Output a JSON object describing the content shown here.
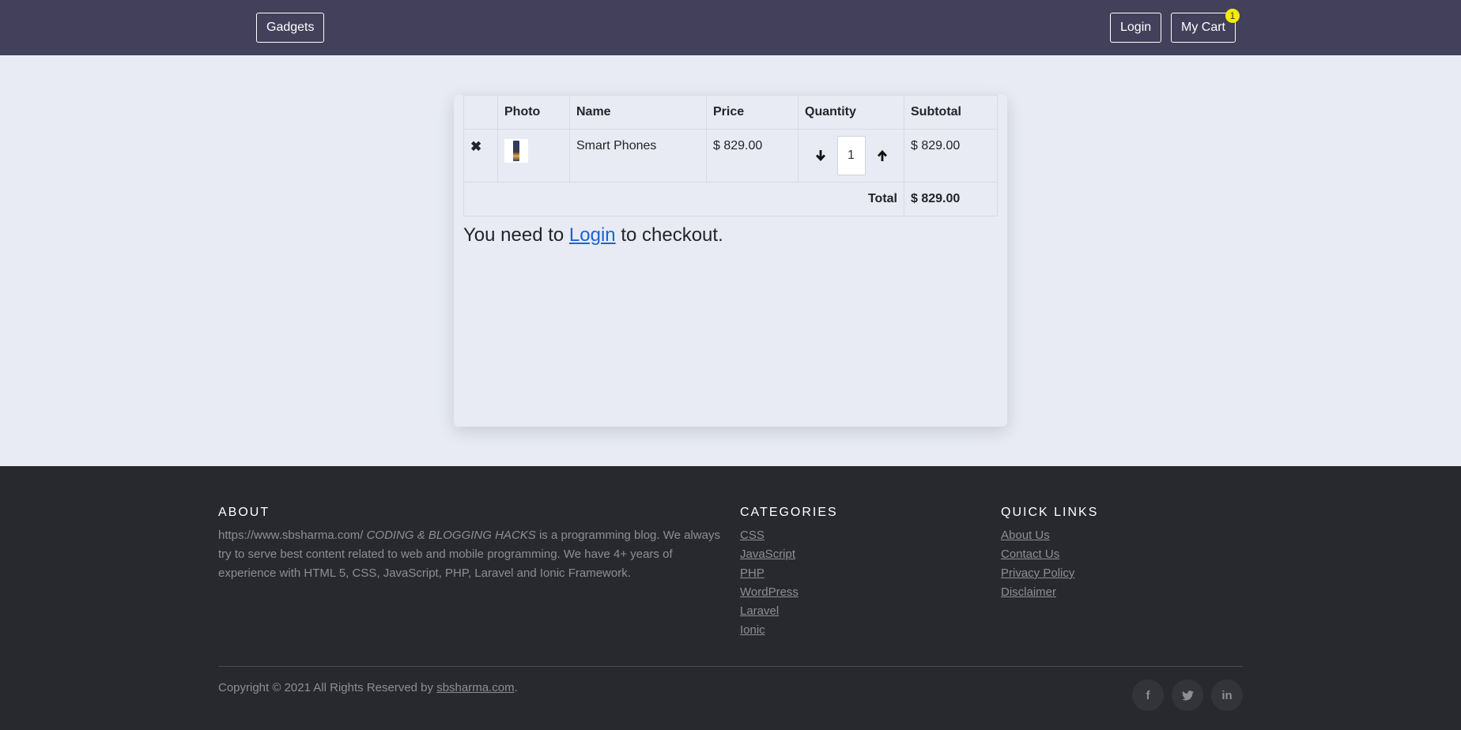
{
  "navbar": {
    "brand": "Gadgets",
    "login_label": "Login",
    "cart_label": "My Cart",
    "cart_count": "1"
  },
  "cart": {
    "headers": [
      "",
      "Photo",
      "Name",
      "Price",
      "Quantity",
      "Subtotal"
    ],
    "items": [
      {
        "remove_icon": "close-icon",
        "photo": "smartphone-photo",
        "name": "Smart Phones",
        "price": "$ 829.00",
        "quantity": "1",
        "subtotal": "$ 829.00"
      }
    ],
    "total_label": "Total",
    "total_value": "$ 829.00",
    "checkout_prefix": "You need to",
    "checkout_link": "Login",
    "checkout_suffix": "to checkout."
  },
  "footer": {
    "about": {
      "heading": "ABOUT",
      "url": "https://www.sbsharma.com/",
      "blog_name": "CODING & BLOGGING HACKS",
      "text": "is a programming blog. We always try to serve best content related to web and mobile programming. We have 4+ years of experience with HTML 5, CSS, JavaScript, PHP, Laravel and Ionic Framework."
    },
    "categories": {
      "heading": "CATEGORIES",
      "items": [
        "CSS",
        "JavaScript",
        "PHP",
        "WordPress",
        "Laravel",
        "Ionic"
      ]
    },
    "quick_links": {
      "heading": "QUICK LINKS",
      "items": [
        "About Us",
        "Contact Us",
        "Privacy Policy",
        "Disclaimer"
      ]
    },
    "copyright_prefix": "Copyright © 2021 All Rights Reserved by",
    "copyright_link": "sbsharma.com",
    "copyright_suffix": ".",
    "social": [
      {
        "icon": "facebook-icon",
        "glyph": "f"
      },
      {
        "icon": "twitter-icon",
        "glyph": "t"
      },
      {
        "icon": "linkedin-icon",
        "glyph": "in"
      }
    ]
  },
  "colors": {
    "navbar_bg": "#42405a",
    "page_bg": "#e8ebf4",
    "footer_bg": "#28292e",
    "badge": "#f5ec00",
    "link": "#1a64d6"
  }
}
